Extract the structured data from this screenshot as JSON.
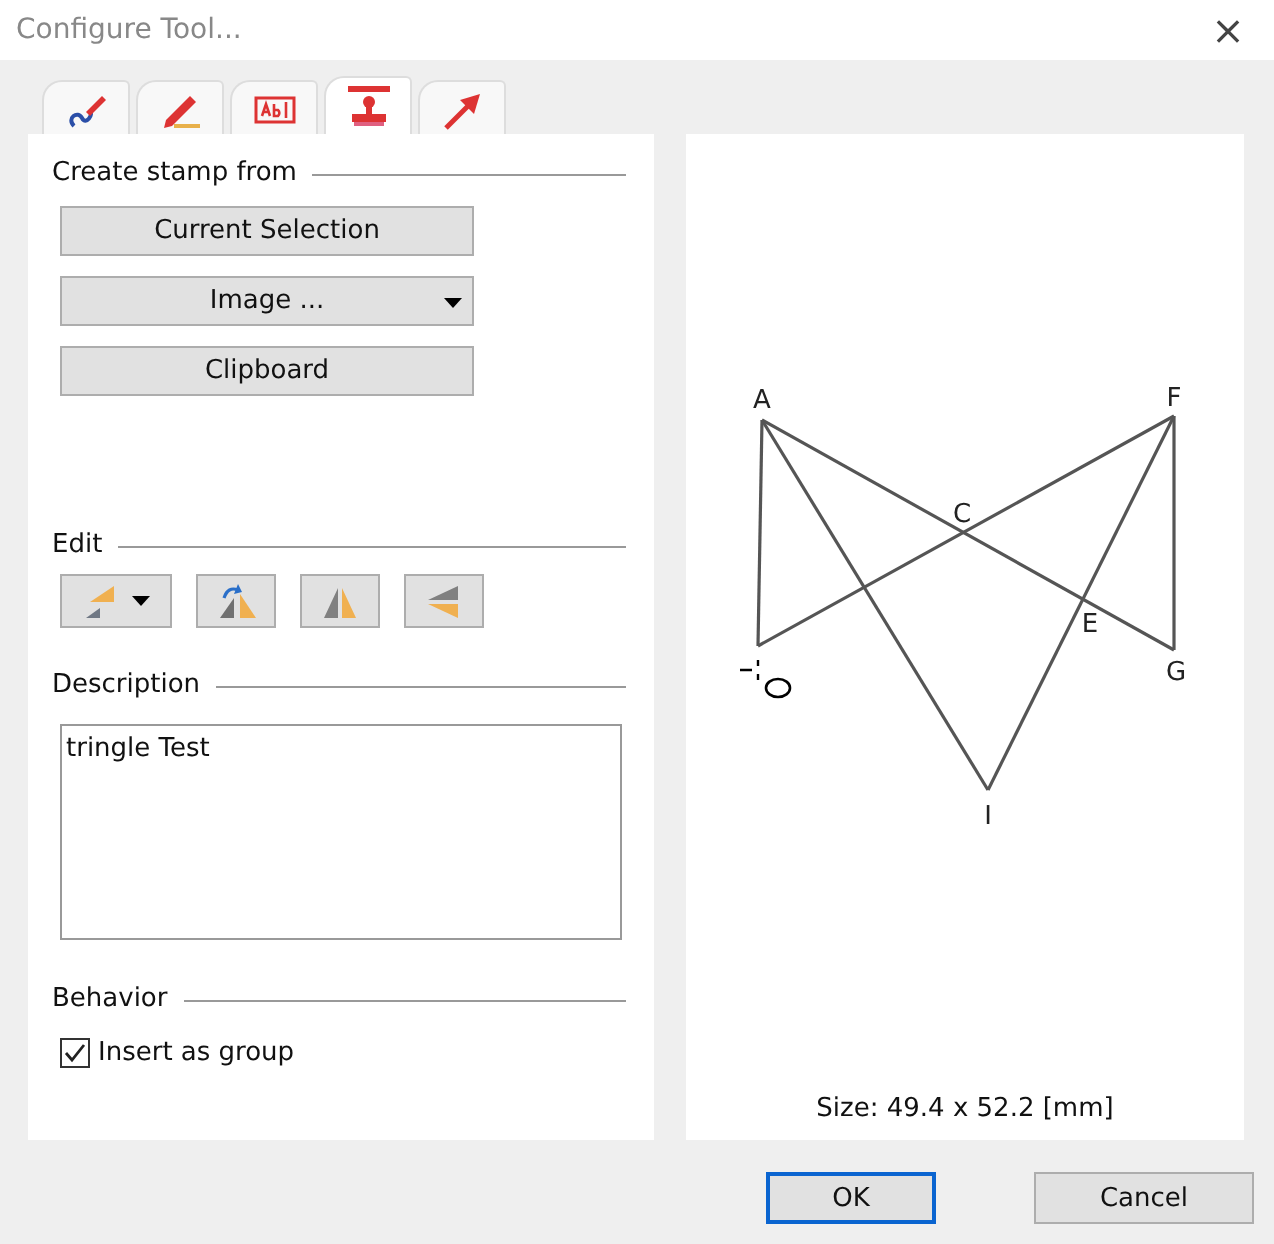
{
  "window": {
    "title": "Configure Tool...",
    "close": "×"
  },
  "tabs": [
    {
      "kind": "curve-pen",
      "selected": false
    },
    {
      "kind": "pencil",
      "selected": false
    },
    {
      "kind": "text-field",
      "selected": false
    },
    {
      "kind": "stamp",
      "selected": true
    },
    {
      "kind": "arrow",
      "selected": false
    }
  ],
  "create_stamp": {
    "heading": "Create stamp from",
    "buttons": [
      {
        "label": "Current Selection",
        "kind": "plain"
      },
      {
        "label": "Image ...",
        "kind": "dropdown"
      },
      {
        "label": "Clipboard",
        "kind": "plain"
      }
    ]
  },
  "edit": {
    "heading": "Edit",
    "tools": [
      {
        "kind": "scale",
        "dropdown": true
      },
      {
        "kind": "rotate",
        "dropdown": false
      },
      {
        "kind": "flip-horizontal",
        "dropdown": false
      },
      {
        "kind": "flip-vertical",
        "dropdown": false
      }
    ]
  },
  "description": {
    "heading": "Description",
    "value": "tringle Test"
  },
  "behavior": {
    "heading": "Behavior",
    "insert_as_group": {
      "label": "Insert as group",
      "checked": true
    }
  },
  "preview": {
    "points": [
      "A",
      "F",
      "C",
      "E",
      "G",
      "I"
    ],
    "size": "Size: 49.4 x 52.2 [mm]"
  },
  "buttons": [
    {
      "label": "OK",
      "default": true
    },
    {
      "label": "Cancel",
      "default": false
    }
  ]
}
